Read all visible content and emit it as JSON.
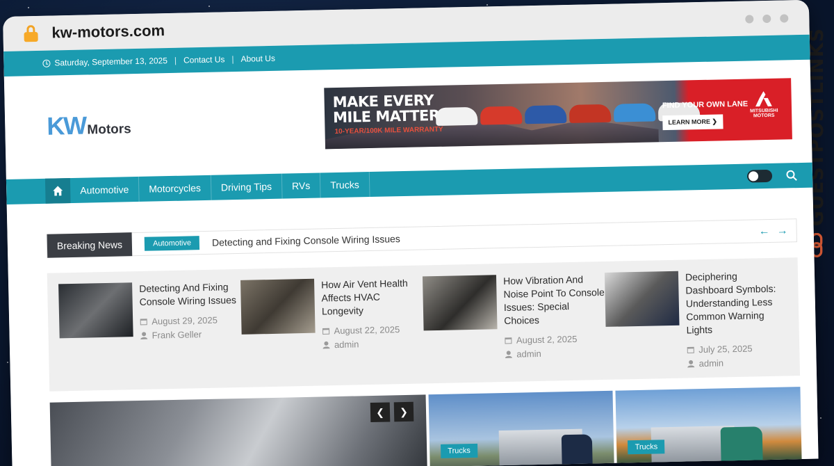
{
  "browser": {
    "url": "kw-motors.com"
  },
  "watermark": {
    "text": "GUESTPOSTLINKS",
    "icon": "link-icon"
  },
  "topbar": {
    "date": "Saturday, September 13, 2025",
    "links": [
      "Contact Us",
      "About Us"
    ]
  },
  "logo": {
    "kw": "KW",
    "motors": "Motors"
  },
  "ad": {
    "headline_1": "MAKE EVERY",
    "headline_2": "MILE MATTER",
    "warranty": "10-YEAR/100K MILE WARRANTY",
    "find_lane": "FIND YOUR OWN LANE",
    "cta": "LEARN MORE",
    "brand": "MITSUBISHI MOTORS"
  },
  "nav": {
    "home_icon": "home-icon",
    "items": [
      "Automotive",
      "Motorcycles",
      "Driving Tips",
      "RVs",
      "Trucks"
    ]
  },
  "breaking": {
    "label": "Breaking News",
    "category": "Automotive",
    "title": "Detecting and Fixing Console Wiring Issues"
  },
  "featured": [
    {
      "title": "Detecting And Fixing Console Wiring Issues",
      "date": "August 29, 2025",
      "author": "Frank Geller"
    },
    {
      "title": "How Air Vent Health Affects HVAC Longevity",
      "date": "August 22, 2025",
      "author": "admin"
    },
    {
      "title": "How Vibration And Noise Point To Console Issues: Special Choices",
      "date": "August 2, 2025",
      "author": "admin"
    },
    {
      "title": "Deciphering Dashboard Symbols: Understanding Less Common Warning Lights",
      "date": "July 25, 2025",
      "author": "admin"
    }
  ],
  "lower": {
    "tags": [
      "Trucks",
      "Trucks"
    ]
  },
  "colors": {
    "accent": "#1b9bb0",
    "dark": "#3b3e44"
  }
}
